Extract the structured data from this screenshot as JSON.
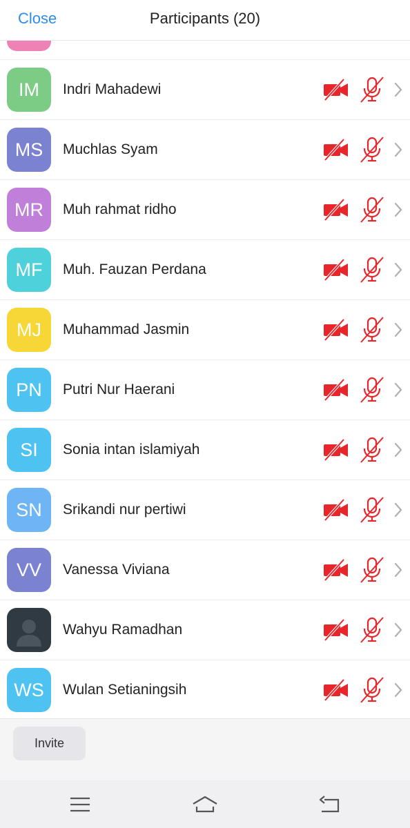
{
  "header": {
    "close_label": "Close",
    "title": "Participants (20)"
  },
  "colors": {
    "accent": "#2d8cf0",
    "muted_red": "#e8252a"
  },
  "participants": [
    {
      "initials": "IM",
      "name": "Indri Mahadewi",
      "color": "#7ccc86",
      "video": "off",
      "audio": "muted"
    },
    {
      "initials": "MS",
      "name": "Muchlas Syam",
      "color": "#7b82cf",
      "video": "off",
      "audio": "muted"
    },
    {
      "initials": "MR",
      "name": "Muh rahmat ridho",
      "color": "#c07fd9",
      "video": "off",
      "audio": "muted"
    },
    {
      "initials": "MF",
      "name": "Muh. Fauzan Perdana",
      "color": "#4fd1db",
      "video": "off",
      "audio": "muted"
    },
    {
      "initials": "MJ",
      "name": "Muhammad Jasmin",
      "color": "#f6d735",
      "video": "off",
      "audio": "muted"
    },
    {
      "initials": "PN",
      "name": "Putri Nur Haerani",
      "color": "#4ec3f2",
      "video": "off",
      "audio": "muted"
    },
    {
      "initials": "SI",
      "name": "Sonia intan islamiyah",
      "color": "#4ec3f2",
      "video": "off",
      "audio": "muted"
    },
    {
      "initials": "SN",
      "name": "Srikandi nur pertiwi",
      "color": "#6db5f5",
      "video": "off",
      "audio": "muted"
    },
    {
      "initials": "VV",
      "name": "Vanessa Viviana",
      "color": "#7b82cf",
      "video": "off",
      "audio": "muted"
    },
    {
      "initials": "",
      "name": "Wahyu Ramadhan",
      "color": "#2f3a42",
      "photo": true,
      "video": "off",
      "audio": "muted"
    },
    {
      "initials": "WS",
      "name": "Wulan Setianingsih",
      "color": "#4ec3f2",
      "video": "off",
      "audio": "muted"
    }
  ],
  "partial_avatar_color": "#ee82b4",
  "footer": {
    "invite_label": "Invite"
  },
  "navbar": {
    "icons": [
      "menu-icon",
      "home-icon",
      "back-icon"
    ]
  }
}
